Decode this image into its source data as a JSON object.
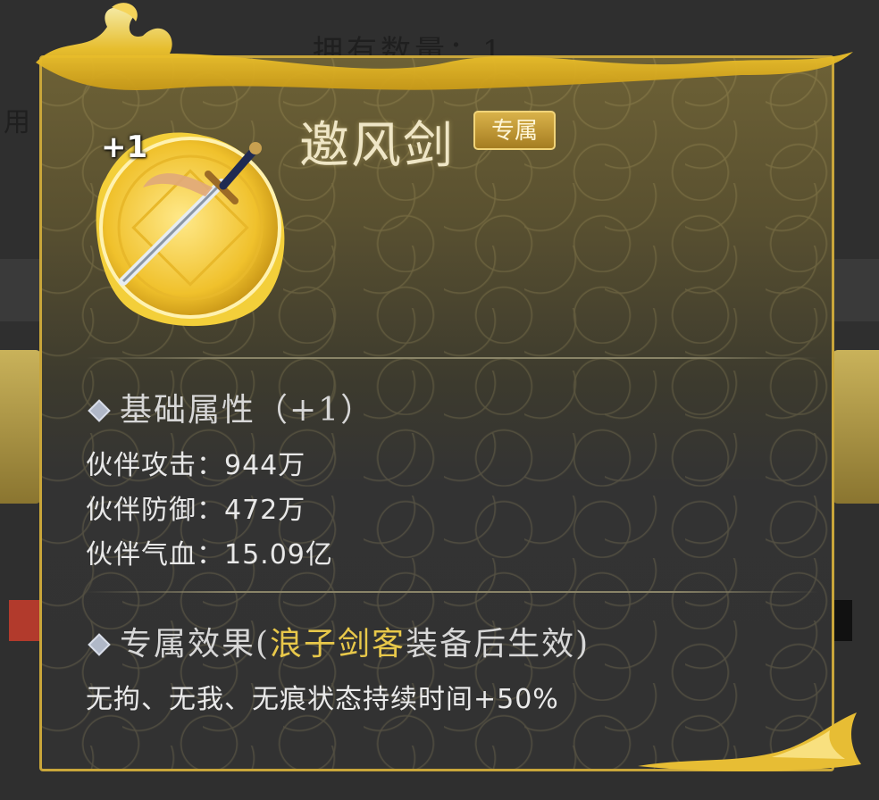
{
  "background": {
    "count_label": "拥有数量：1",
    "use_label": "用"
  },
  "item": {
    "name": "邀风剑",
    "badge": "专属",
    "level": "+1",
    "icon": "sword-icon"
  },
  "base_attributes": {
    "header": "基础属性（+1）",
    "stats": [
      {
        "label": "伙伴攻击：",
        "value": "944万"
      },
      {
        "label": "伙伴防御：",
        "value": "472万"
      },
      {
        "label": "伙伴气血：",
        "value": "15.09亿"
      }
    ]
  },
  "exclusive": {
    "header_prefix": "专属效果(",
    "hero_name": "浪子剑客",
    "header_suffix": "装备后生效)",
    "effect": "无拘、无我、无痕状态持续时间+50%"
  },
  "colors": {
    "accent_gold": "#e8c84a",
    "frame_gold": "#c9a63a"
  }
}
